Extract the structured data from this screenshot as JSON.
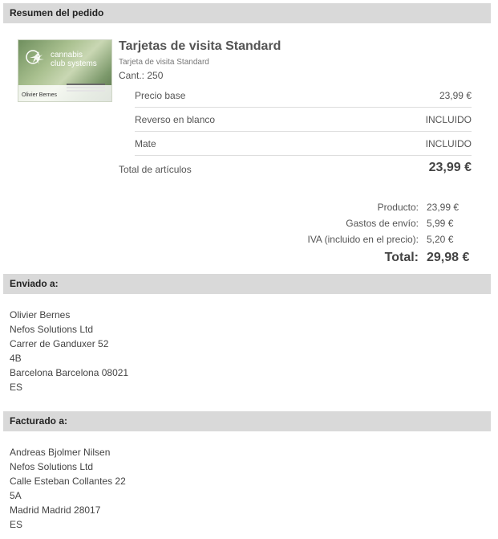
{
  "summary": {
    "header": "Resumen del pedido",
    "thumbnail": {
      "brand_line1": "cannabis",
      "brand_line2": "club systems",
      "card_name": "Olivier Bernes"
    },
    "product": {
      "title": "Tarjetas de visita Standard",
      "subtitle": "Tarjeta de visita Standard",
      "quantity": "Cant.: 250"
    },
    "options": [
      {
        "label": "Precio base",
        "value": "23,99 €"
      },
      {
        "label": "Reverso en blanco",
        "value": "INCLUIDO"
      },
      {
        "label": "Mate",
        "value": "INCLUIDO"
      }
    ],
    "items_total": {
      "label": "Total de artículos",
      "value": "23,99 €"
    },
    "totals": [
      {
        "label": "Producto:",
        "value": "23,99 €"
      },
      {
        "label": "Gastos de envío:",
        "value": "5,99 €"
      },
      {
        "label": "IVA (incluido en el precio):",
        "value": "5,20 €"
      }
    ],
    "grand_total": {
      "label": "Total:",
      "value": "29,98 €"
    }
  },
  "shipping": {
    "header": "Enviado a:",
    "lines": [
      "Olivier Bernes",
      "Nefos Solutions Ltd",
      "Carrer de Ganduxer 52",
      "4B",
      "Barcelona Barcelona 08021",
      "ES"
    ]
  },
  "billing": {
    "header": "Facturado a:",
    "lines": [
      "Andreas Bjolmer Nilsen",
      "Nefos Solutions Ltd",
      "Calle Esteban Collantes 22",
      "5A",
      "Madrid Madrid 28017",
      "ES"
    ]
  }
}
